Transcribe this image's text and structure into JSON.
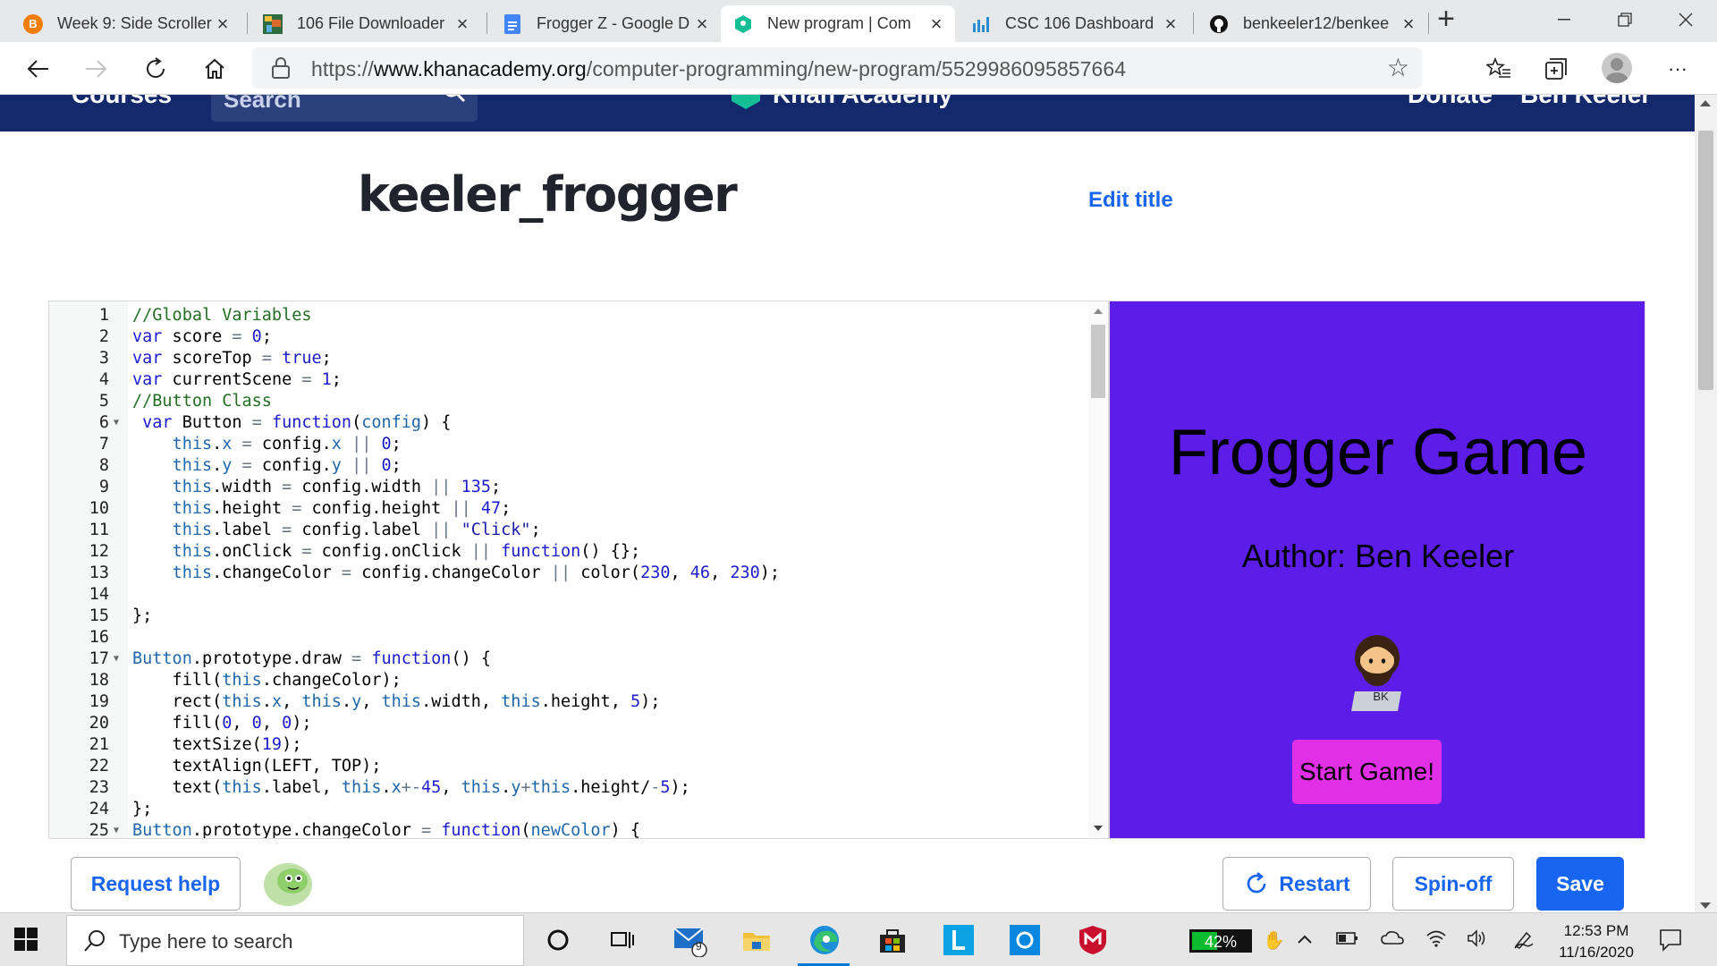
{
  "browser": {
    "tabs": [
      {
        "label": "Week 9: Side Scroller",
        "icon": "blogger-icon",
        "color": "#f57d00"
      },
      {
        "label": "106 File Downloader",
        "icon": "pixel-art-icon",
        "color": "#2f8f3f"
      },
      {
        "label": "Frogger Z - Google D",
        "icon": "google-docs-icon",
        "color": "#4285f4"
      },
      {
        "label": "New program | Com",
        "icon": "khan-academy-icon",
        "color": "#14bf96",
        "active": true
      },
      {
        "label": "CSC 106 Dashboard",
        "icon": "bar-chart-icon",
        "color": "#2c8cd0"
      },
      {
        "label": "benkeeler12/benkee",
        "icon": "github-icon",
        "color": "#111111"
      }
    ],
    "new_tab_glyph": "+",
    "address": {
      "scheme": "https://",
      "host": "www.khanacademy.org",
      "path": "/computer-programming/new-program/5529986095857664"
    }
  },
  "ka_header": {
    "courses": "Courses",
    "search": "Search",
    "logo_text": "Khan Academy",
    "donate": "Donate",
    "user": "Ben Keeler"
  },
  "program": {
    "title": "keeler_frogger",
    "edit_title": "Edit title"
  },
  "code_lines": [
    {
      "n": "1",
      "fold": false,
      "html": [
        [
          "t-cm",
          "//Global Variables"
        ]
      ]
    },
    {
      "n": "2",
      "fold": false,
      "html": [
        [
          "t-kw",
          "var"
        ],
        [
          "",
          " score "
        ],
        [
          "t-op",
          "="
        ],
        [
          "",
          " "
        ],
        [
          "t-num",
          "0"
        ],
        [
          "",
          ";"
        ]
      ]
    },
    {
      "n": "3",
      "fold": false,
      "html": [
        [
          "t-kw",
          "var"
        ],
        [
          "",
          " scoreTop "
        ],
        [
          "t-op",
          "="
        ],
        [
          "",
          " "
        ],
        [
          "t-kw",
          "true"
        ],
        [
          "",
          ";"
        ]
      ]
    },
    {
      "n": "4",
      "fold": false,
      "html": [
        [
          "t-kw",
          "var"
        ],
        [
          "",
          " currentScene "
        ],
        [
          "t-op",
          "="
        ],
        [
          "",
          " "
        ],
        [
          "t-num",
          "1"
        ],
        [
          "",
          ";"
        ]
      ]
    },
    {
      "n": "5",
      "fold": false,
      "html": [
        [
          "t-cm",
          "//Button Class"
        ]
      ]
    },
    {
      "n": "6",
      "fold": true,
      "html": [
        [
          "",
          " "
        ],
        [
          "t-kw",
          "var"
        ],
        [
          "",
          " Button "
        ],
        [
          "t-op",
          "="
        ],
        [
          "",
          " "
        ],
        [
          "t-kw",
          "function"
        ],
        [
          "",
          "("
        ],
        [
          "t-this",
          "config"
        ],
        [
          "",
          ") {"
        ]
      ]
    },
    {
      "n": "7",
      "fold": false,
      "html": [
        [
          "",
          "    "
        ],
        [
          "t-this",
          "this"
        ],
        [
          "",
          "."
        ],
        [
          "t-prop",
          "x"
        ],
        [
          "",
          " "
        ],
        [
          "t-op",
          "="
        ],
        [
          "",
          " config."
        ],
        [
          "t-prop",
          "x"
        ],
        [
          "",
          " "
        ],
        [
          "t-op",
          "||"
        ],
        [
          "",
          " "
        ],
        [
          "t-num",
          "0"
        ],
        [
          "",
          ";"
        ]
      ]
    },
    {
      "n": "8",
      "fold": false,
      "html": [
        [
          "",
          "    "
        ],
        [
          "t-this",
          "this"
        ],
        [
          "",
          "."
        ],
        [
          "t-prop",
          "y"
        ],
        [
          "",
          " "
        ],
        [
          "t-op",
          "="
        ],
        [
          "",
          " config."
        ],
        [
          "t-prop",
          "y"
        ],
        [
          "",
          " "
        ],
        [
          "t-op",
          "||"
        ],
        [
          "",
          " "
        ],
        [
          "t-num",
          "0"
        ],
        [
          "",
          ";"
        ]
      ]
    },
    {
      "n": "9",
      "fold": false,
      "html": [
        [
          "",
          "    "
        ],
        [
          "t-this",
          "this"
        ],
        [
          "",
          ".width "
        ],
        [
          "t-op",
          "="
        ],
        [
          "",
          " config.width "
        ],
        [
          "t-op",
          "||"
        ],
        [
          "",
          " "
        ],
        [
          "t-num",
          "135"
        ],
        [
          "",
          ";"
        ]
      ]
    },
    {
      "n": "10",
      "fold": false,
      "html": [
        [
          "",
          "    "
        ],
        [
          "t-this",
          "this"
        ],
        [
          "",
          ".height "
        ],
        [
          "t-op",
          "="
        ],
        [
          "",
          " config.height "
        ],
        [
          "t-op",
          "||"
        ],
        [
          "",
          " "
        ],
        [
          "t-num",
          "47"
        ],
        [
          "",
          ";"
        ]
      ]
    },
    {
      "n": "11",
      "fold": false,
      "html": [
        [
          "",
          "    "
        ],
        [
          "t-this",
          "this"
        ],
        [
          "",
          ".label "
        ],
        [
          "t-op",
          "="
        ],
        [
          "",
          " config.label "
        ],
        [
          "t-op",
          "||"
        ],
        [
          "",
          " "
        ],
        [
          "t-str",
          "\"Click\""
        ],
        [
          "",
          ";"
        ]
      ]
    },
    {
      "n": "12",
      "fold": false,
      "html": [
        [
          "",
          "    "
        ],
        [
          "t-this",
          "this"
        ],
        [
          "",
          ".onClick "
        ],
        [
          "t-op",
          "="
        ],
        [
          "",
          " config.onClick "
        ],
        [
          "t-op",
          "||"
        ],
        [
          "",
          " "
        ],
        [
          "t-kw",
          "function"
        ],
        [
          "",
          "() {};"
        ]
      ]
    },
    {
      "n": "13",
      "fold": false,
      "html": [
        [
          "",
          "    "
        ],
        [
          "t-this",
          "this"
        ],
        [
          "",
          ".changeColor "
        ],
        [
          "t-op",
          "="
        ],
        [
          "",
          " config.changeColor "
        ],
        [
          "t-op",
          "||"
        ],
        [
          "",
          " color("
        ],
        [
          "t-num",
          "230"
        ],
        [
          "",
          ", "
        ],
        [
          "t-num",
          "46"
        ],
        [
          "",
          ", "
        ],
        [
          "t-num",
          "230"
        ],
        [
          "",
          ");"
        ]
      ]
    },
    {
      "n": "14",
      "fold": false,
      "html": []
    },
    {
      "n": "15",
      "fold": false,
      "html": [
        [
          "",
          "};"
        ]
      ]
    },
    {
      "n": "16",
      "fold": false,
      "html": []
    },
    {
      "n": "17",
      "fold": true,
      "html": [
        [
          "t-this",
          "Button"
        ],
        [
          "",
          ".prototype.draw "
        ],
        [
          "t-op",
          "="
        ],
        [
          "",
          " "
        ],
        [
          "t-kw",
          "function"
        ],
        [
          "",
          "() {"
        ]
      ]
    },
    {
      "n": "18",
      "fold": false,
      "html": [
        [
          "",
          "    fill("
        ],
        [
          "t-this",
          "this"
        ],
        [
          "",
          ".changeColor);"
        ]
      ]
    },
    {
      "n": "19",
      "fold": false,
      "html": [
        [
          "",
          "    rect("
        ],
        [
          "t-this",
          "this"
        ],
        [
          "",
          "."
        ],
        [
          "t-prop",
          "x"
        ],
        [
          "",
          ", "
        ],
        [
          "t-this",
          "this"
        ],
        [
          "",
          "."
        ],
        [
          "t-prop",
          "y"
        ],
        [
          "",
          ", "
        ],
        [
          "t-this",
          "this"
        ],
        [
          "",
          ".width, "
        ],
        [
          "t-this",
          "this"
        ],
        [
          "",
          ".height, "
        ],
        [
          "t-num",
          "5"
        ],
        [
          "",
          ");"
        ]
      ]
    },
    {
      "n": "20",
      "fold": false,
      "html": [
        [
          "",
          "    fill("
        ],
        [
          "t-num",
          "0"
        ],
        [
          "",
          ", "
        ],
        [
          "t-num",
          "0"
        ],
        [
          "",
          ", "
        ],
        [
          "t-num",
          "0"
        ],
        [
          "",
          ");"
        ]
      ]
    },
    {
      "n": "21",
      "fold": false,
      "html": [
        [
          "",
          "    textSize("
        ],
        [
          "t-num",
          "19"
        ],
        [
          "",
          ");"
        ]
      ]
    },
    {
      "n": "22",
      "fold": false,
      "html": [
        [
          "",
          "    textAlign(LEFT, TOP);"
        ]
      ]
    },
    {
      "n": "23",
      "fold": false,
      "html": [
        [
          "",
          "    text("
        ],
        [
          "t-this",
          "this"
        ],
        [
          "",
          ".label, "
        ],
        [
          "t-this",
          "this"
        ],
        [
          "",
          "."
        ],
        [
          "t-prop",
          "x"
        ],
        [
          "t-op",
          "+-"
        ],
        [
          "t-num",
          "45"
        ],
        [
          "",
          ", "
        ],
        [
          "t-this",
          "this"
        ],
        [
          "",
          "."
        ],
        [
          "t-prop",
          "y"
        ],
        [
          "t-op",
          "+"
        ],
        [
          "t-this",
          "this"
        ],
        [
          "",
          ".height/"
        ],
        [
          "t-op",
          "-"
        ],
        [
          "t-num",
          "5"
        ],
        [
          "",
          ");"
        ]
      ]
    },
    {
      "n": "24",
      "fold": false,
      "html": [
        [
          "",
          "};"
        ]
      ]
    },
    {
      "n": "25",
      "fold": true,
      "html": [
        [
          "t-this",
          "Button"
        ],
        [
          "",
          ".prototype.changeColor "
        ],
        [
          "t-op",
          "="
        ],
        [
          "",
          " "
        ],
        [
          "t-kw",
          "function"
        ],
        [
          "",
          "("
        ],
        [
          "t-this",
          "newColor"
        ],
        [
          "",
          ") {"
        ]
      ]
    }
  ],
  "canvas": {
    "background": "#5c1de8",
    "title": "Frogger Game",
    "author": "Author: Ben Keeler",
    "avatar_badge": "BK",
    "start_button": "Start Game!",
    "start_button_color": "#e02fe6"
  },
  "actions": {
    "request_help": "Request help",
    "restart": "Restart",
    "spinoff": "Spin-off",
    "save": "Save"
  },
  "taskbar": {
    "search_placeholder": "Type here to search",
    "mail_badge": "9",
    "battery": "42%",
    "time": "12:53 PM",
    "date": "11/16/2020"
  },
  "colors": {
    "ka_header": "#14296b",
    "accent_blue": "#1865f2"
  }
}
